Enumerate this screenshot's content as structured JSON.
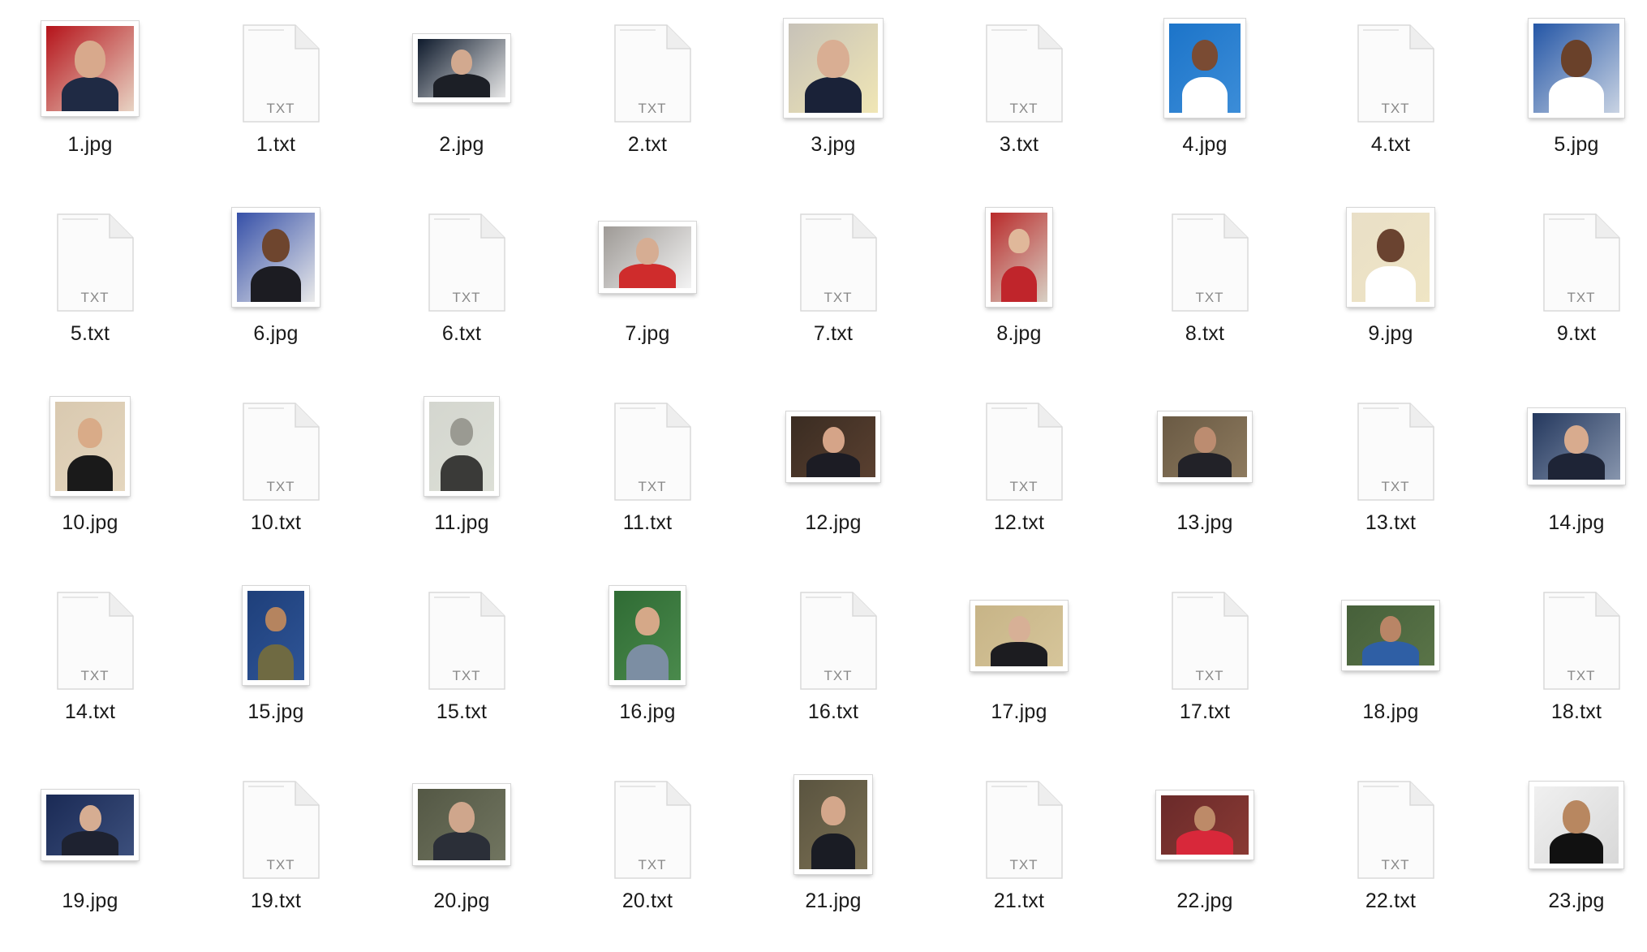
{
  "files": [
    {
      "name": "1.jpg",
      "kind": "image",
      "c": [
        "#b5131a",
        "#e8d4c4",
        "#1f2a44",
        "#d8a98c"
      ]
    },
    {
      "name": "1.txt",
      "kind": "text",
      "badge": "TXT"
    },
    {
      "name": "2.jpg",
      "kind": "image",
      "c": [
        "#0e1a2c",
        "#e7e7e7",
        "#1c1f26",
        "#d2a98f"
      ]
    },
    {
      "name": "2.txt",
      "kind": "text",
      "badge": "TXT"
    },
    {
      "name": "3.jpg",
      "kind": "image",
      "c": [
        "#c7c2b8",
        "#f0e6b5",
        "#1a2238",
        "#d9ae93"
      ]
    },
    {
      "name": "3.txt",
      "kind": "text",
      "badge": "TXT"
    },
    {
      "name": "4.jpg",
      "kind": "image",
      "c": [
        "#1c74c9",
        "#3c8dd8",
        "#ffffff",
        "#7a4b33"
      ]
    },
    {
      "name": "4.txt",
      "kind": "text",
      "badge": "TXT"
    },
    {
      "name": "5.jpg",
      "kind": "image",
      "c": [
        "#2456a6",
        "#c9d3e3",
        "#ffffff",
        "#6a412a"
      ]
    },
    {
      "name": "5.txt",
      "kind": "text",
      "badge": "TXT"
    },
    {
      "name": "6.jpg",
      "kind": "image",
      "c": [
        "#3650a8",
        "#eaeaea",
        "#1c1c22",
        "#6e452e"
      ]
    },
    {
      "name": "6.txt",
      "kind": "text",
      "badge": "TXT"
    },
    {
      "name": "7.jpg",
      "kind": "image",
      "c": [
        "#9e9a96",
        "#f3f3f3",
        "#cf2c2c",
        "#d6ad93"
      ]
    },
    {
      "name": "7.txt",
      "kind": "text",
      "badge": "TXT"
    },
    {
      "name": "8.jpg",
      "kind": "image",
      "c": [
        "#b92a2a",
        "#d8d0c4",
        "#c0252b",
        "#e0b89a"
      ]
    },
    {
      "name": "8.txt",
      "kind": "text",
      "badge": "TXT"
    },
    {
      "name": "9.jpg",
      "kind": "image",
      "c": [
        "#e9dfc7",
        "#efe5c4",
        "#ffffff",
        "#6a4330"
      ]
    },
    {
      "name": "9.txt",
      "kind": "text",
      "badge": "TXT"
    },
    {
      "name": "10.jpg",
      "kind": "image",
      "c": [
        "#d9c9b0",
        "#e4d6be",
        "#1a1a1a",
        "#d9ab88"
      ]
    },
    {
      "name": "10.txt",
      "kind": "text",
      "badge": "TXT"
    },
    {
      "name": "11.jpg",
      "kind": "image",
      "c": [
        "#d4d6cf",
        "#dcdfd6",
        "#3a3a38",
        "#9a9a92"
      ]
    },
    {
      "name": "11.txt",
      "kind": "text",
      "badge": "TXT"
    },
    {
      "name": "12.jpg",
      "kind": "image",
      "c": [
        "#3a2c22",
        "#5a4030",
        "#1c1c24",
        "#d5a488"
      ]
    },
    {
      "name": "12.txt",
      "kind": "text",
      "badge": "TXT"
    },
    {
      "name": "13.jpg",
      "kind": "image",
      "c": [
        "#6a5a44",
        "#8d7a5e",
        "#222228",
        "#bc8c70"
      ]
    },
    {
      "name": "13.txt",
      "kind": "text",
      "badge": "TXT"
    },
    {
      "name": "14.jpg",
      "kind": "image",
      "c": [
        "#24385e",
        "#8795ad",
        "#1e2436",
        "#d8ab8e"
      ]
    },
    {
      "name": "14.txt",
      "kind": "text",
      "badge": "TXT"
    },
    {
      "name": "15.jpg",
      "kind": "image",
      "c": [
        "#1e3f7a",
        "#2f5597",
        "#6f6a42",
        "#b5845f"
      ]
    },
    {
      "name": "15.txt",
      "kind": "text",
      "badge": "TXT"
    },
    {
      "name": "16.jpg",
      "kind": "image",
      "c": [
        "#2f6b34",
        "#4a8a4c",
        "#7c8ea3",
        "#d5a888"
      ]
    },
    {
      "name": "16.txt",
      "kind": "text",
      "badge": "TXT"
    },
    {
      "name": "17.jpg",
      "kind": "image",
      "c": [
        "#c7b487",
        "#d6c59a",
        "#1c1c20",
        "#d7b096"
      ]
    },
    {
      "name": "17.txt",
      "kind": "text",
      "badge": "TXT"
    },
    {
      "name": "18.jpg",
      "kind": "image",
      "c": [
        "#46603a",
        "#5a7448",
        "#2f5fa5",
        "#b98566"
      ]
    },
    {
      "name": "18.txt",
      "kind": "text",
      "badge": "TXT"
    },
    {
      "name": "19.jpg",
      "kind": "image",
      "c": [
        "#1a2a55",
        "#3c4f7c",
        "#1e2230",
        "#d6ad92"
      ]
    },
    {
      "name": "19.txt",
      "kind": "text",
      "badge": "TXT"
    },
    {
      "name": "20.jpg",
      "kind": "image",
      "c": [
        "#545845",
        "#717560",
        "#2b2f38",
        "#cfa68c"
      ]
    },
    {
      "name": "20.txt",
      "kind": "text",
      "badge": "TXT"
    },
    {
      "name": "21.jpg",
      "kind": "image",
      "c": [
        "#5a5440",
        "#7a6f52",
        "#1a1c24",
        "#d4a78b"
      ]
    },
    {
      "name": "21.txt",
      "kind": "text",
      "badge": "TXT"
    },
    {
      "name": "22.jpg",
      "kind": "image",
      "c": [
        "#6a2a2a",
        "#8a3a34",
        "#d8283a",
        "#bd8a68"
      ]
    },
    {
      "name": "22.txt",
      "kind": "text",
      "badge": "TXT"
    },
    {
      "name": "23.jpg",
      "kind": "image",
      "c": [
        "#f0f0f0",
        "#d8d8d8",
        "#111111",
        "#b88760"
      ]
    }
  ]
}
